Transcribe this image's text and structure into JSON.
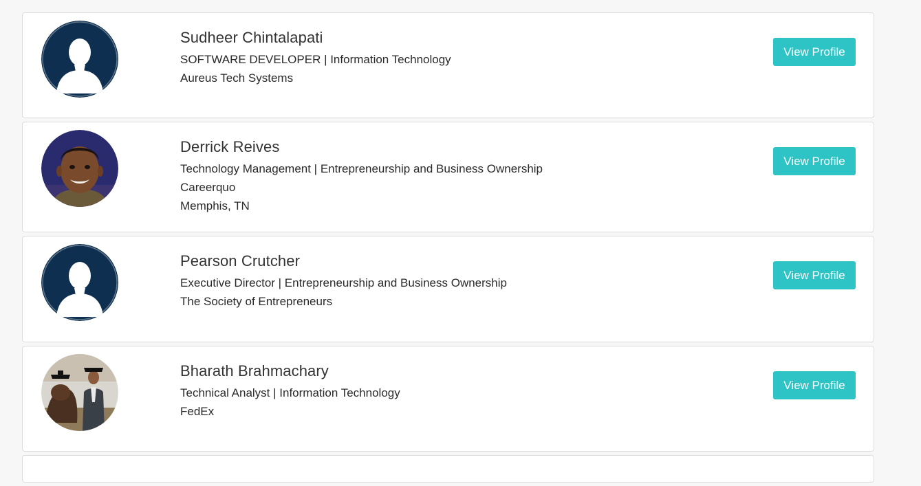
{
  "profiles": [
    {
      "name": "Sudheer Chintalapati",
      "line1": "SOFTWARE DEVELOPER | Information Technology",
      "line2": "Aureus Tech Systems",
      "line3": "",
      "button_label": "View Profile",
      "avatar": "default-silhouette"
    },
    {
      "name": "Derrick Reives",
      "line1": "Technology Management | Entrepreneurship and Business Ownership",
      "line2": "Careerquo",
      "line3": "Memphis, TN",
      "button_label": "View Profile",
      "avatar": "photo"
    },
    {
      "name": "Pearson Crutcher",
      "line1": "Executive Director | Entrepreneurship and Business Ownership",
      "line2": "The Society of Entrepreneurs",
      "line3": "",
      "button_label": "View Profile",
      "avatar": "default-silhouette"
    },
    {
      "name": "Bharath Brahmachary",
      "line1": "Technical Analyst | Information Technology",
      "line2": "FedEx",
      "line3": "",
      "button_label": "View Profile",
      "avatar": "photo"
    }
  ],
  "colors": {
    "button_bg": "#2ec4c6",
    "avatar_default_bg": "#0e2f4f",
    "page_bg": "#f7f7f8"
  }
}
